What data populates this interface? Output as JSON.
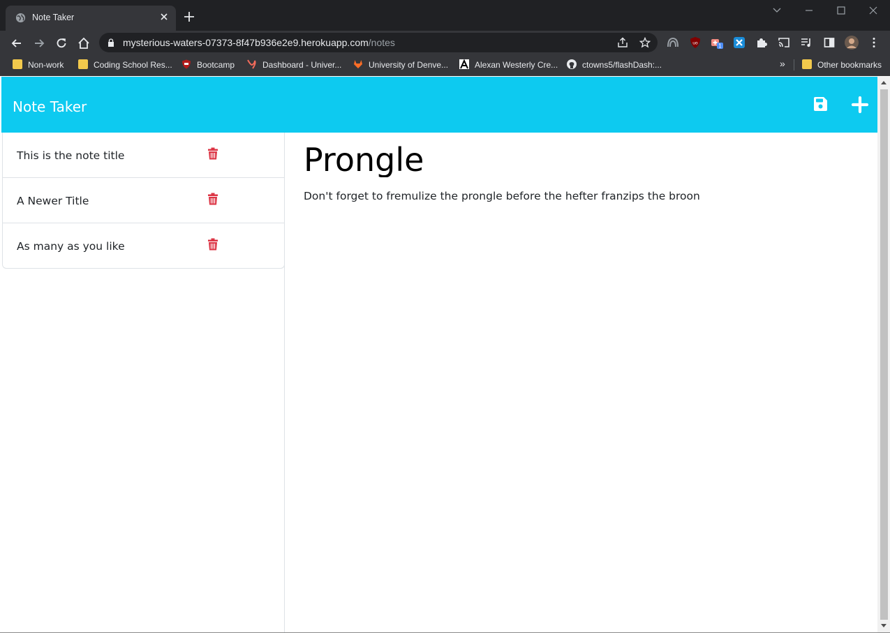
{
  "browser": {
    "tab_title": "Note Taker",
    "url_host": "mysterious-waters-07373-8f47b936e2e9.herokuapp.com",
    "url_path": "/notes",
    "extension_badge": "1",
    "bookmarks": [
      {
        "label": "Non-work",
        "icon": "folder-icon"
      },
      {
        "label": "Coding School Res...",
        "icon": "folder-icon"
      },
      {
        "label": "Bootcamp",
        "icon": "shield-icon"
      },
      {
        "label": "Dashboard - Univer...",
        "icon": "y-icon"
      },
      {
        "label": "University of Denve...",
        "icon": "gitlab-icon"
      },
      {
        "label": "Alexan Westerly Cre...",
        "icon": "a-icon"
      },
      {
        "label": "ctowns5/flashDash:...",
        "icon": "github-icon"
      }
    ],
    "overflow": "»",
    "other_bookmarks": "Other bookmarks"
  },
  "app": {
    "brand": "Note Taker",
    "notes": [
      {
        "title": "This is the note title"
      },
      {
        "title": "A Newer Title"
      },
      {
        "title": "As many as you like"
      }
    ],
    "active_note": {
      "title": "Prongle",
      "text": "Don't forget to fremulize the prongle before the hefter franzips the broon"
    }
  },
  "colors": {
    "navbar": "#0dcaf0",
    "trash": "#dc3545",
    "chrome_dark": "#202124",
    "chrome_toolbar": "#35363a"
  }
}
